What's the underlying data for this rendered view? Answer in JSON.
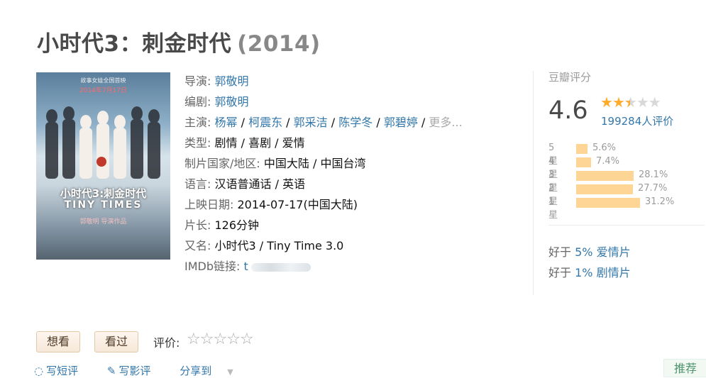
{
  "title": "小时代3：刺金时代",
  "year": "(2014)",
  "poster": {
    "line1": "故事女娃全国首映",
    "line2": "2014年7月17日",
    "title_cn": "小时代3:刺金时代",
    "title_en": "TINY TIMES",
    "credit": "郭敬明 导演作品"
  },
  "info": {
    "director_label": "导演:",
    "director": "郭敬明",
    "writer_label": "编剧:",
    "writer": "郭敬明",
    "cast_label": "主演:",
    "cast": [
      "杨幂",
      "柯震东",
      "郭采洁",
      "陈学冬",
      "郭碧婷"
    ],
    "cast_more": "更多...",
    "genre_label": "类型:",
    "genres": [
      "剧情",
      "喜剧",
      "爱情"
    ],
    "country_label": "制片国家/地区:",
    "country": "中国大陆 / 中国台湾",
    "language_label": "语言:",
    "language": "汉语普通话 / 英语",
    "release_label": "上映日期:",
    "release": "2014-07-17(中国大陆)",
    "runtime_label": "片长:",
    "runtime": "126分钟",
    "aka_label": "又名:",
    "aka": "小时代3 / Tiny Time 3.0",
    "imdb_label": "IMDb链接:",
    "imdb": "t"
  },
  "rating": {
    "header": "豆瓣评分",
    "score": "4.6",
    "stars_value": 2.5,
    "votes": "199284人评价",
    "distribution": [
      {
        "label": "5星",
        "percent": "5.6%",
        "value": 5.6
      },
      {
        "label": "4星",
        "percent": "7.4%",
        "value": 7.4
      },
      {
        "label": "3星",
        "percent": "28.1%",
        "value": 28.1
      },
      {
        "label": "2星",
        "percent": "27.7%",
        "value": 27.7
      },
      {
        "label": "1星",
        "percent": "31.2%",
        "value": 31.2
      }
    ],
    "better_than": [
      {
        "prefix": "好于",
        "value": "5% 爱情片"
      },
      {
        "prefix": "好于",
        "value": "1% 剧情片"
      }
    ]
  },
  "actions": {
    "want_label": "想看",
    "seen_label": "看过",
    "rate_label": "评价:",
    "short_review": "写短评",
    "review": "写影评",
    "share": "分享到",
    "recommend": "推荐"
  },
  "colors": {
    "link": "#3377aa",
    "star": "#ffac2d",
    "bar": "#ffd596"
  }
}
